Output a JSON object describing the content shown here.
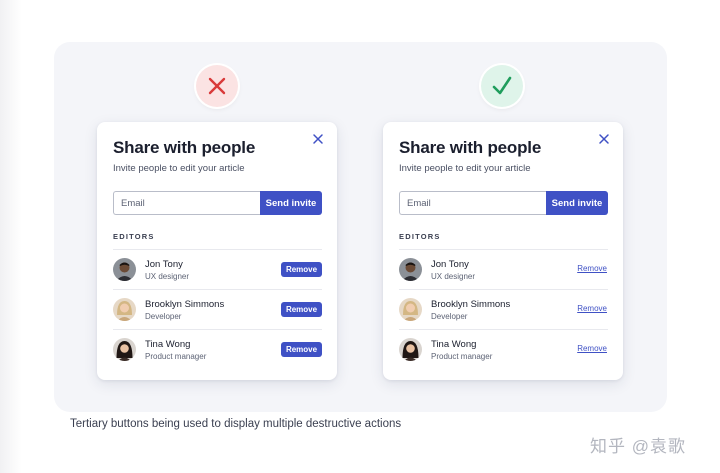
{
  "caption": "Tertiary buttons being used to display multiple destructive actions",
  "watermark": "知乎 @袁歌",
  "colors": {
    "accent": "#3f51c5",
    "bad": "#d93a3a",
    "good": "#1f9d5c"
  },
  "bad_example": {
    "badge_icon": "x-icon",
    "title": "Share with people",
    "subtitle": "Invite people to edit your article",
    "email_placeholder": "Email",
    "send_label": "Send invite",
    "section_label": "EDITORS",
    "editors": [
      {
        "name": "Jon Tony",
        "role": "UX designer",
        "action": "Remove"
      },
      {
        "name": "Brooklyn Simmons",
        "role": "Developer",
        "action": "Remove"
      },
      {
        "name": "Tina Wong",
        "role": "Product manager",
        "action": "Remove"
      }
    ]
  },
  "good_example": {
    "badge_icon": "checkmark-icon",
    "title": "Share with people",
    "subtitle": "Invite people to edit your article",
    "email_placeholder": "Email",
    "send_label": "Send invite",
    "section_label": "EDITORS",
    "editors": [
      {
        "name": "Jon Tony",
        "role": "UX designer",
        "action": "Remove"
      },
      {
        "name": "Brooklyn Simmons",
        "role": "Developer",
        "action": "Remove"
      },
      {
        "name": "Tina Wong",
        "role": "Product manager",
        "action": "Remove"
      }
    ]
  }
}
